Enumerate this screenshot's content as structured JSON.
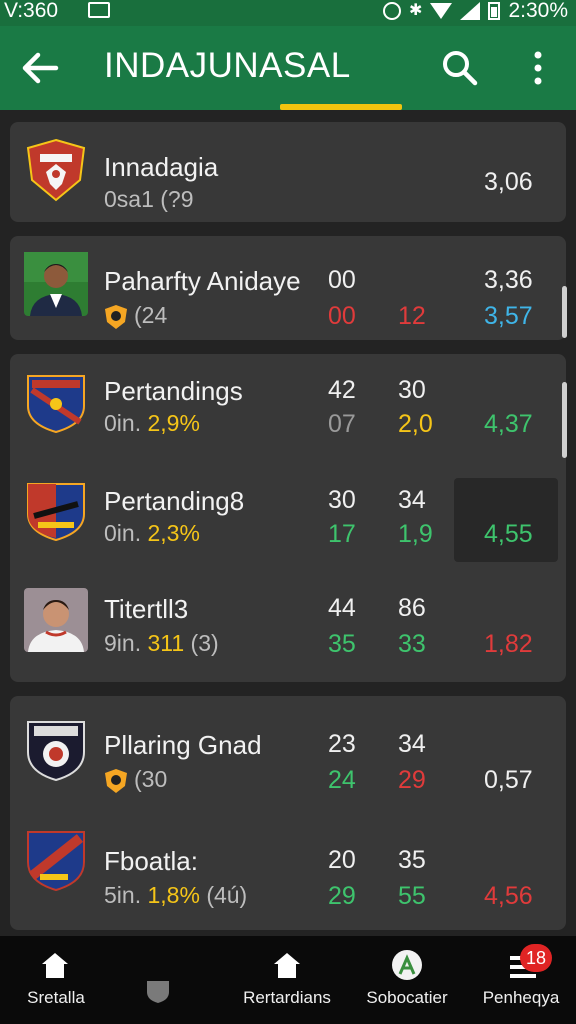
{
  "status_bar": {
    "left_text": "V:360",
    "time": "2:30%"
  },
  "app_bar": {
    "title": "INDAJUNASAL"
  },
  "groups": [
    {
      "rows": [
        {
          "name": "Innadagia",
          "sub": "0sa1 (?9",
          "value": "3,06"
        }
      ]
    },
    {
      "rows": [
        {
          "name": "Paharfty Anidaye",
          "col1_top": "00",
          "col1_bottom": "00",
          "col2_bottom": "12",
          "value_top": "3,36",
          "value_bottom": "3,57",
          "sub": "(24"
        }
      ]
    },
    {
      "rows": [
        {
          "name": "Pertandings",
          "sub_prefix": "0in.",
          "sub_highlight": "2,9%",
          "col1_top": "42",
          "col2_top": "30",
          "col1_bottom": "07",
          "col2_bottom": "2,0",
          "value": "4,37"
        },
        {
          "name": "Pertanding8",
          "sub_prefix": "0in.",
          "sub_highlight": "2,3%",
          "col1_top": "30",
          "col2_top": "34",
          "col1_bottom": "17",
          "col2_bottom": "1,9",
          "value": "4,55"
        },
        {
          "name": "Titertll3",
          "sub_prefix": "9in.",
          "sub_highlight": "311",
          "sub_suffix": "(3)",
          "col1_top": "44",
          "col2_top": "86",
          "col1_bottom": "35",
          "col2_bottom": "33",
          "value": "1,82"
        }
      ]
    },
    {
      "rows": [
        {
          "name": "Pllaring Gnad",
          "sub": "(30",
          "col1_top": "23",
          "col2_top": "34",
          "col1_bottom": "24",
          "col2_bottom": "29",
          "value": "0,57"
        },
        {
          "name": "Fboatla:",
          "sub_prefix": "5in.",
          "sub_highlight": "1,8%",
          "sub_suffix": "(4ú)",
          "col1_top": "20",
          "col2_top": "35",
          "col1_bottom": "29",
          "col2_bottom": "55",
          "value": "4,56"
        }
      ]
    }
  ],
  "bottom_nav": [
    {
      "label": "Sretalla",
      "icon": "home-icon"
    },
    {
      "label": "",
      "icon": "shield-icon"
    },
    {
      "label": "Rertardians",
      "icon": "home-icon"
    },
    {
      "label": "Sobocatier",
      "icon": "soccer-icon"
    },
    {
      "label": "Penheqya",
      "icon": "menu-icon",
      "badge": "18"
    }
  ],
  "colors": {
    "app_bar": "#1a7a45",
    "accent": "#f1c40f",
    "positive": "#3ec46d",
    "negative": "#e03b3b"
  }
}
